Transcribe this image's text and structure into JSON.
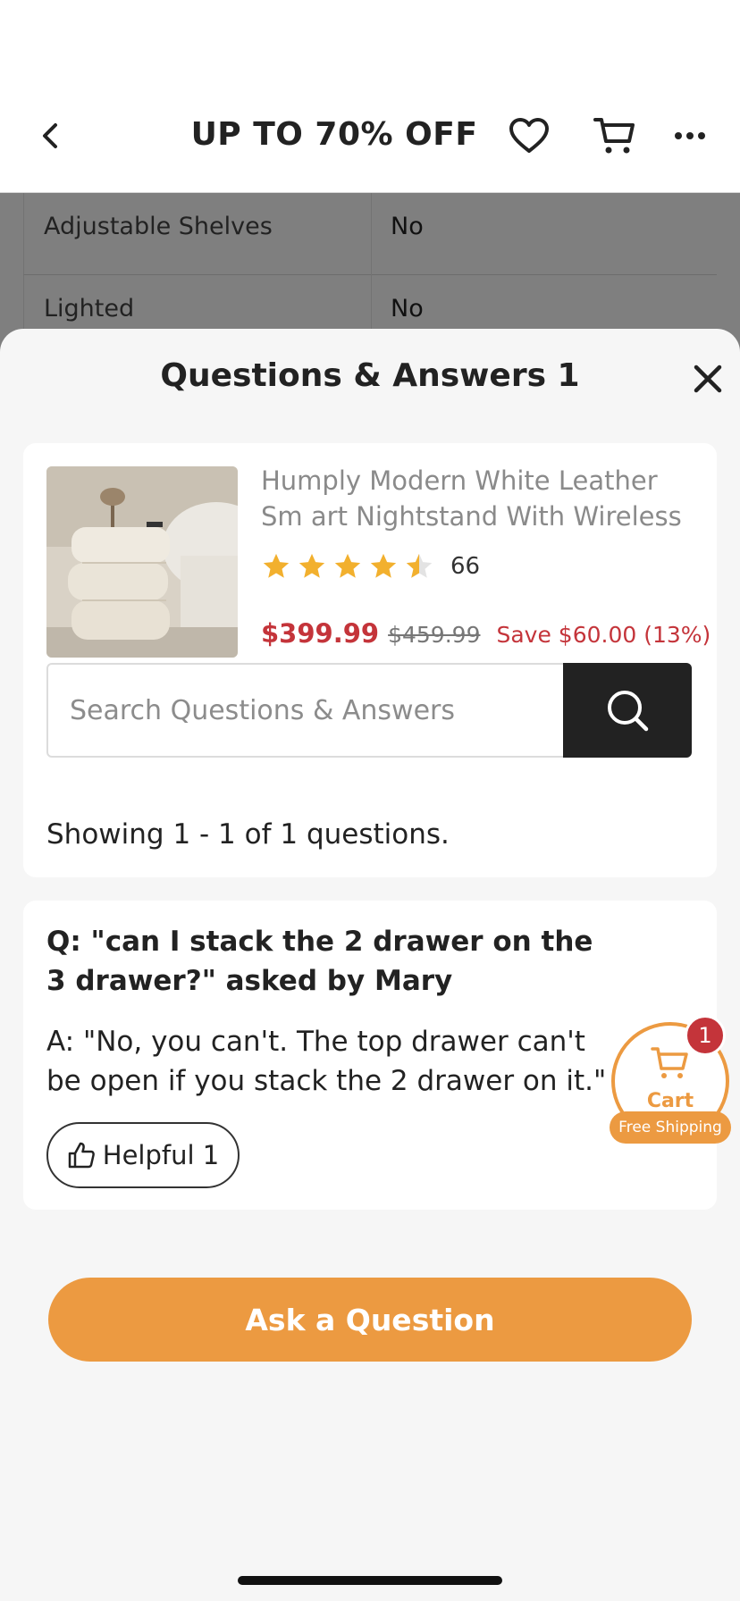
{
  "navbar": {
    "title": "UP TO 70% OFF",
    "icons": [
      "back-chevron-icon",
      "heart-icon",
      "cart-icon",
      "more-icon"
    ]
  },
  "specs": [
    {
      "key": "Adjustable Shelves",
      "value": "No"
    },
    {
      "key": "Lighted",
      "value": "No"
    }
  ],
  "sheet": {
    "title": "Questions & Answers 1"
  },
  "product": {
    "name": "Humply Modern White Leather Sm art Nightstand With Wireless Char...",
    "rating": 4.5,
    "rating_count": "66",
    "price": "$399.99",
    "original_price": "$459.99",
    "savings": "Save $60.00 (13%)"
  },
  "search": {
    "placeholder": "Search Questions & Answers",
    "value": ""
  },
  "results": {
    "showing": "Showing 1 - 1 of 1 questions."
  },
  "qa": [
    {
      "question": "Q: \"can I stack the 2 drawer on the 3 drawer?\" asked by Mary",
      "answer": "A: \"No, you can't. The top drawer can't be open if you stack the 2 drawer on it.\"",
      "helpful_label": "Helpful 1"
    }
  ],
  "ask_button": "Ask a Question",
  "cart_widget": {
    "label": "Cart",
    "badge": "1",
    "shipping": "Free Shipping"
  },
  "colors": {
    "accent": "#ec9a41",
    "price_red": "#c4343a",
    "dark": "#222222"
  }
}
